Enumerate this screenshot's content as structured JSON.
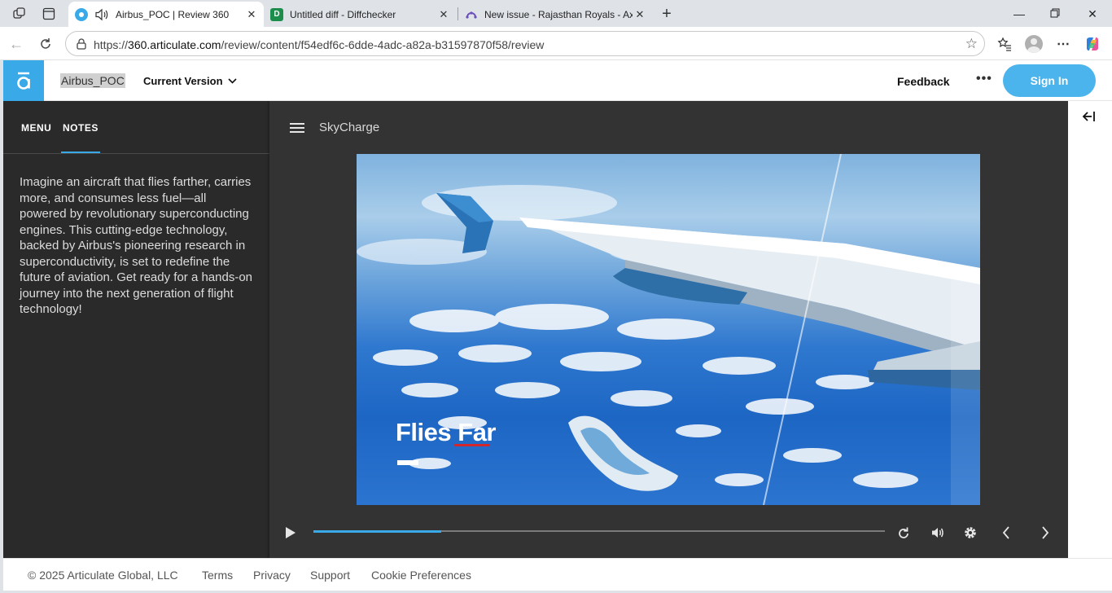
{
  "browser": {
    "tabs": [
      {
        "title": "Airbus_POC | Review 360",
        "active": true
      },
      {
        "title": "Untitled diff - Diffchecker",
        "favicon": "D",
        "active": false
      },
      {
        "title": "New issue - Rajasthan Royals - Ax",
        "active": false
      }
    ],
    "url_scheme": "https://",
    "url_host": "360.articulate.com",
    "url_path": "/review/content/f54edf6c-6dde-4adc-a82a-b31597870f58/review",
    "colors": {
      "tabbar": "#dfe3e8",
      "active_tab": "#ffffff"
    }
  },
  "header": {
    "logo_letter": "a",
    "course_title": "Airbus_POC",
    "version_label": "Current Version",
    "feedback_label": "Feedback",
    "more_label": "•••",
    "signin_label": "Sign In",
    "colors": {
      "accent": "#3aa9e8",
      "signin": "#4cb4ec"
    }
  },
  "sidebar": {
    "tabs": [
      {
        "label": "MENU",
        "active": false
      },
      {
        "label": "NOTES",
        "active": true
      }
    ],
    "notes": "Imagine an aircraft that flies farther, carries more, and consumes less fuel—all powered by revolutionary superconducting engines. This cutting-edge technology, backed by Airbus's pioneering research in superconductivity, is set to redefine the future of aviation. Get ready for a hands-on journey into the next generation of flight technology!"
  },
  "player": {
    "title": "SkyCharge",
    "slide_caption": "Flies Far",
    "progress_fraction": 0.223
  },
  "footer": {
    "copyright": "© 2025 Articulate Global, LLC",
    "links": [
      "Terms",
      "Privacy",
      "Support",
      "Cookie Preferences"
    ]
  }
}
